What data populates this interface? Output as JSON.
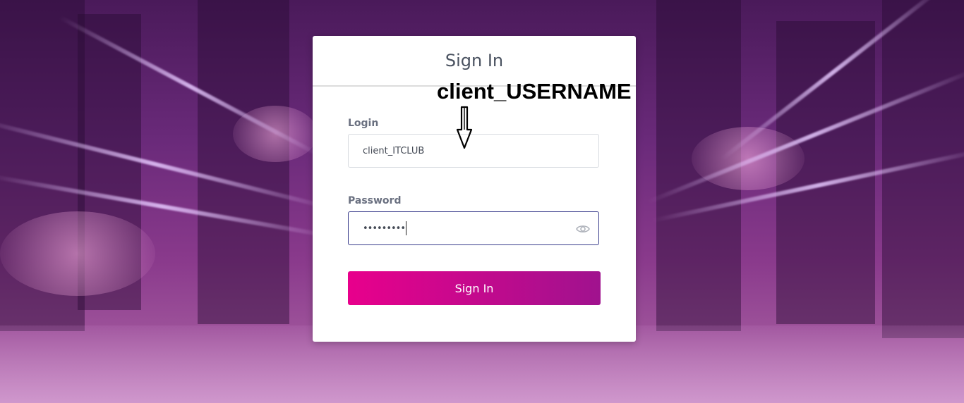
{
  "card": {
    "title": "Sign In"
  },
  "login": {
    "label": "Login",
    "value": "client_ITCLUB"
  },
  "password": {
    "label": "Password",
    "masked_value": "•••••••••"
  },
  "submit": {
    "label": "Sign In"
  },
  "annotation": {
    "text": "client_USERNAME"
  },
  "icons": {
    "password_toggle": "eye-icon",
    "annotation_arrow": "down-arrow-icon"
  },
  "colors": {
    "button_start": "#e8008c",
    "button_end": "#a0128e",
    "focus_border": "#3a3d8c"
  }
}
